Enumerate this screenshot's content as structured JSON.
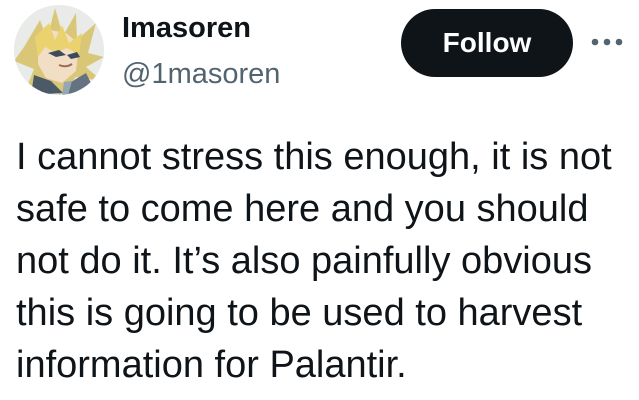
{
  "user": {
    "display_name": "Imasoren",
    "handle": "@1masoren",
    "avatar": "spiky-blond-anime-avatar"
  },
  "actions": {
    "follow_label": "Follow",
    "more_icon": "more-icon"
  },
  "tweet": {
    "text": "I cannot stress this enough, it is not\nsafe to come here and you should\nnot do it. It’s also painfully obvious\nthis is going to be used to harvest\ninformation for Palantir."
  },
  "colors": {
    "text": "#0f1419",
    "secondary_text": "#536471",
    "follow_background": "#0f1419",
    "follow_text": "#ffffff",
    "background": "#ffffff"
  }
}
